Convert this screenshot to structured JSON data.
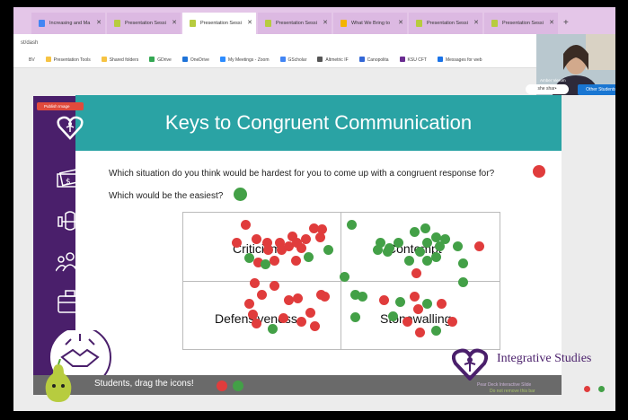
{
  "browser": {
    "tabs": [
      {
        "label": "Increasing and Ma",
        "active": false,
        "icon": "doc-icon"
      },
      {
        "label": "Presentation Sessi",
        "active": false,
        "icon": "pear-icon"
      },
      {
        "label": "Presentation Sessi",
        "active": true,
        "icon": "pear-icon"
      },
      {
        "label": "Presentation Sessi",
        "active": false,
        "icon": "pear-icon"
      },
      {
        "label": "What We Bring to",
        "active": false,
        "icon": "slides-icon"
      },
      {
        "label": "Presentation Sessi",
        "active": false,
        "icon": "pear-icon"
      },
      {
        "label": "Presentation Sessi",
        "active": false,
        "icon": "pear-icon"
      }
    ],
    "new_tab": "+",
    "close_glyph": "✕",
    "address": "st/dash",
    "bookmarks": [
      {
        "label": "BV",
        "color": "#ffffff"
      },
      {
        "label": "Presentation Tools",
        "color": "#f6c343"
      },
      {
        "label": "Shared folders",
        "color": "#f6c343"
      },
      {
        "label": "GDrive",
        "color": "#34a853"
      },
      {
        "label": "OneDrive",
        "color": "#1e73d8"
      },
      {
        "label": "My Meetings - Zoom",
        "color": "#2d8cff"
      },
      {
        "label": "GScholar",
        "color": "#4285f4"
      },
      {
        "label": "Altmetric IF",
        "color": "#555555"
      },
      {
        "label": "Canopolita",
        "color": "#3367d6"
      },
      {
        "label": "KSU CFT",
        "color": "#6a2c91"
      },
      {
        "label": "Messages for web",
        "color": "#1a73e8"
      }
    ]
  },
  "meet": {
    "participant_name": "Amber Vierum",
    "share_label": "she shar•",
    "other_students_button": "Other Students"
  },
  "slide": {
    "publish_label": "Publish Image",
    "title": "Keys to Congruent Communication",
    "question_hardest": "Which situation do you think would be hardest for you to come up with a congruent response for?",
    "question_easiest": "Which would be the easiest?",
    "quadrants": [
      "Criticism",
      "Contempt",
      "Defensiveness",
      "Stonewalling"
    ],
    "bottom_prompt": "Students, drag the icons!",
    "logo_title": "Integrative Studies",
    "logo_line1": "Pear Deck Interactive Slide",
    "logo_line2": "Do not remove this bar",
    "colors": {
      "red": "#e03c3c",
      "green": "#43a047",
      "teal": "#2aa3a4",
      "purple": "#4a1f6b"
    }
  }
}
